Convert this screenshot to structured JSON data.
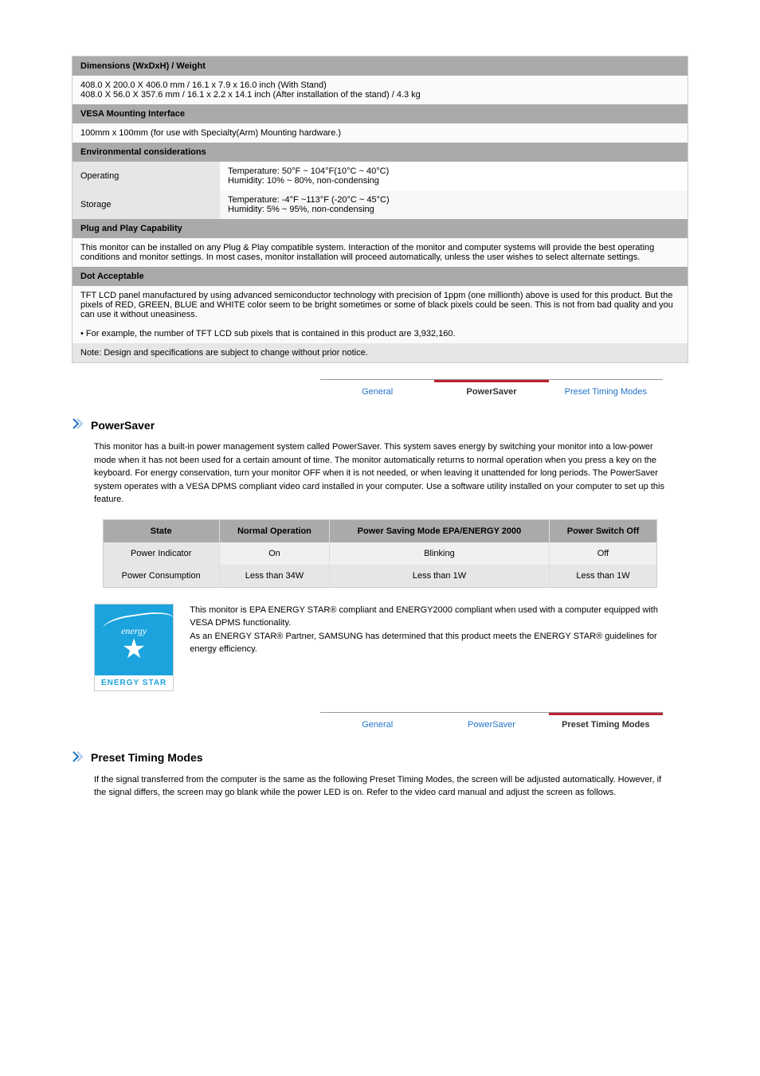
{
  "spec": {
    "s1": {
      "h": "Dimensions (WxDxH) / Weight",
      "v": "408.0 X 200.0 X 406.0 mm / 16.1 x 7.9 x 16.0 inch (With Stand)\n408.0 X 56.0 X 357.6 mm / 16.1 x 2.2 x 14.1 inch (After installation of the stand) / 4.3 kg"
    },
    "s2": {
      "h": "VESA Mounting Interface",
      "v": "100mm x 100mm (for use with Specialty(Arm) Mounting hardware.)"
    },
    "s3": {
      "h": "Environmental considerations",
      "rows": [
        {
          "l": "Operating",
          "v": "Temperature: 50°F ~ 104°F(10°C ~ 40°C)\nHumidity: 10% ~ 80%, non-condensing"
        },
        {
          "l": "Storage",
          "v": "Temperature: -4°F ~113°F (-20°C ~ 45°C)\nHumidity: 5% ~ 95%, non-condensing"
        }
      ]
    },
    "s4": {
      "h": "Plug and Play Capability",
      "v": "This monitor can be installed on any Plug & Play compatible system. Interaction of the monitor and computer systems will provide the best operating conditions and monitor settings. In most cases, monitor installation will proceed automatically, unless the user wishes to select alternate settings."
    },
    "s5": {
      "h": "Dot Acceptable",
      "v": "TFT LCD panel manufactured by using advanced semiconductor technology with precision of 1ppm (one millionth) above is used for this product. But the pixels of RED, GREEN, BLUE and WHITE color seem to be bright sometimes or some of black pixels could be seen. This is not from bad quality and you can use it without uneasiness.",
      "b": "For example, the number of TFT LCD sub pixels that is contained in this product are 3,932,160."
    },
    "note": "Note: Design and specifications are subject to change without prior notice."
  },
  "tabs": {
    "general": "General",
    "powersaver": "PowerSaver",
    "preset": "Preset Timing Modes"
  },
  "powersaver": {
    "title": "PowerSaver",
    "para": "This monitor has a built-in power management system called PowerSaver. This system saves energy by switching your monitor into a low-power mode when it has not been used for a certain amount of time. The monitor automatically returns to normal operation when you press a key on the keyboard. For energy conservation, turn your monitor OFF when it is not needed, or when leaving it unattended for long periods. The PowerSaver system operates with a VESA DPMS compliant video card installed in your computer. Use a software utility installed on your computer to set up this feature.",
    "table": {
      "headers": [
        "State",
        "Normal Operation",
        "Power Saving Mode EPA/ENERGY 2000",
        "Power Switch Off"
      ],
      "rows": [
        [
          "Power Indicator",
          "On",
          "Blinking",
          "Off"
        ],
        [
          "Power Consumption",
          "Less than 34W",
          "Less than 1W",
          "Less than 1W"
        ]
      ]
    },
    "estar": {
      "script": "energy",
      "bar": "ENERGY STAR",
      "text": "This monitor is EPA ENERGY STAR® compliant and ENERGY2000 compliant when used with a computer equipped with VESA DPMS functionality.\nAs an ENERGY STAR® Partner, SAMSUNG has determined that this product meets the ENERGY STAR® guidelines for energy efficiency."
    }
  },
  "preset": {
    "title": "Preset Timing Modes",
    "para": "If the signal transferred from the computer is the same as the following Preset Timing Modes, the screen will be adjusted automatically. However, if the signal differs, the screen may go blank while the power LED is on. Refer to the video card manual and adjust the screen as follows."
  }
}
